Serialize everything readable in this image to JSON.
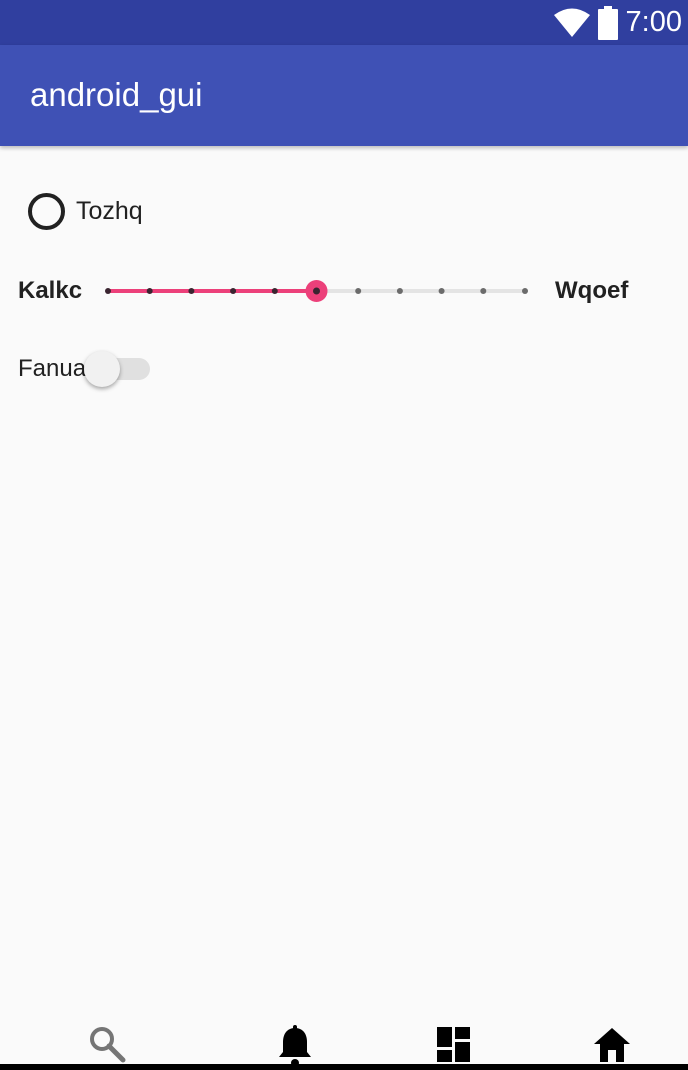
{
  "status_bar": {
    "time": "7:00",
    "icons": [
      "wifi-icon",
      "battery-icon"
    ],
    "background": "#303f9f"
  },
  "app_bar": {
    "title": "android_gui",
    "background": "#3f51b5"
  },
  "radio": {
    "label": "Tozhq",
    "checked": false
  },
  "slider": {
    "min_label": "Kalkc",
    "max_label": "Wqoef",
    "steps": 10,
    "value_index": 5,
    "accent": "#ec407a"
  },
  "switch": {
    "label": "Fanua",
    "on": false
  },
  "bottom_nav": {
    "items": [
      {
        "icon": "search-icon"
      },
      {
        "icon": "bell-icon"
      },
      {
        "icon": "dashboard-icon"
      },
      {
        "icon": "home-icon"
      }
    ]
  }
}
